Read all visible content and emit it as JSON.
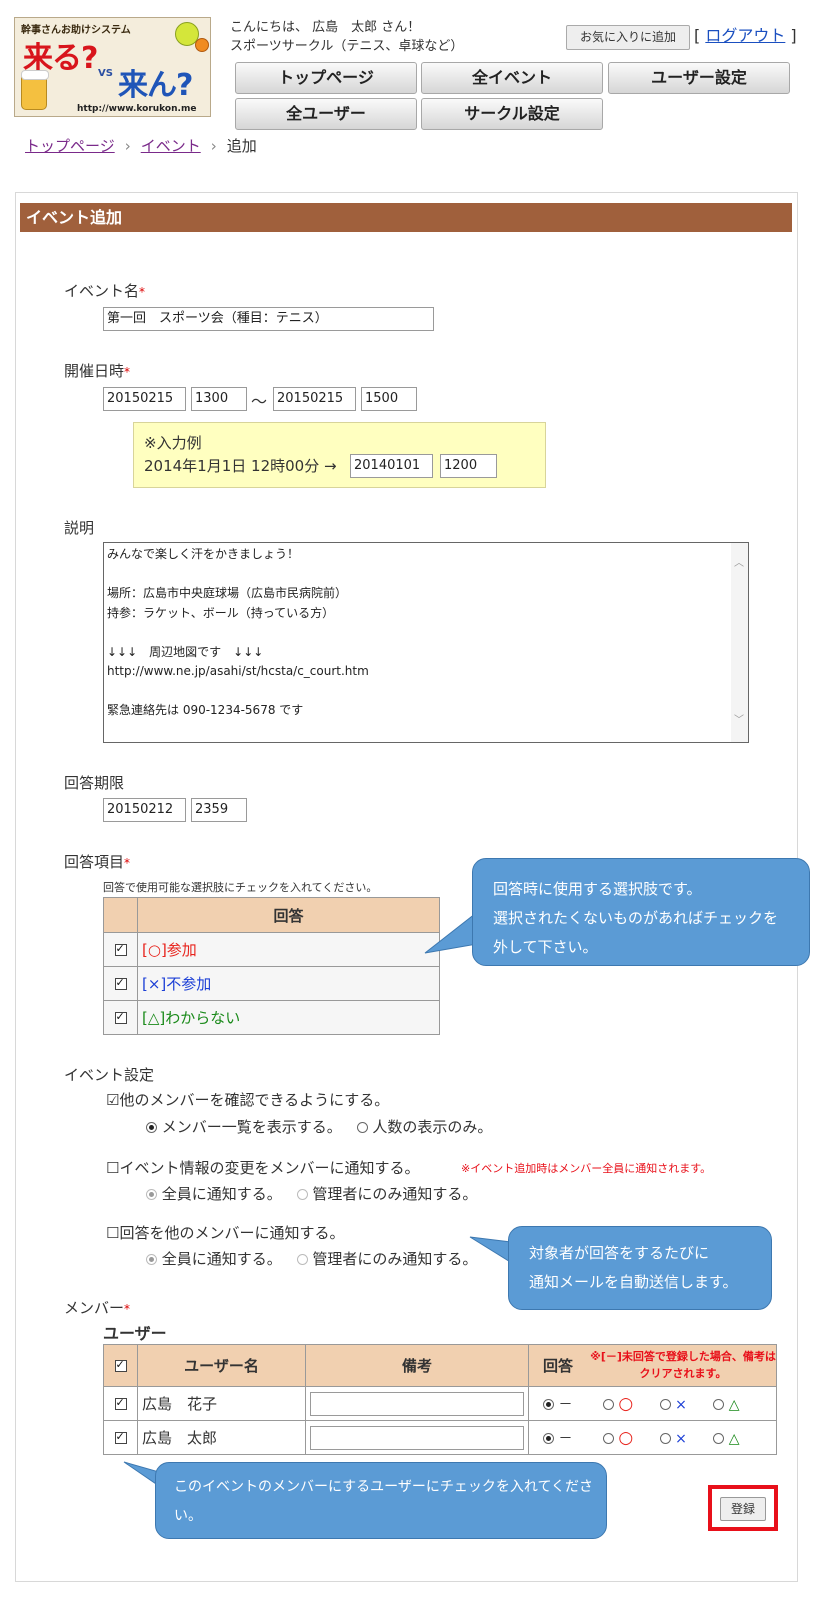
{
  "header": {
    "logo": {
      "tagline": "幹事さんお助けシステム",
      "word1": "来る?",
      "vs": "VS",
      "word2": "来ん?",
      "url": "http://www.korukon.me"
    },
    "greeting": "こんにちは、 広島　太郎 さん！",
    "circle_name": "スポーツサークル（テニス、卓球など）",
    "favorite_button": "お気に入りに追加",
    "logout_label": "ログアウト",
    "nav": [
      "トップページ",
      "全イベント",
      "ユーザー設定",
      "全ユーザー",
      "サークル設定"
    ]
  },
  "breadcrumb": {
    "items": [
      "トップページ",
      "イベント"
    ],
    "current": "追加",
    "separator": "›"
  },
  "panel_title": "イベント追加",
  "form": {
    "event_name_label": "イベント名",
    "required_mark": "*",
    "event_name_value": "第一回　スポーツ会（種目：テニス）",
    "datetime_label": "開催日時",
    "start_date": "20150215",
    "start_time": "1300",
    "tilde": "〜",
    "end_date": "20150215",
    "end_time": "1500",
    "example_title": "※入力例",
    "example_text": "2014年1月1日 12時00分 →",
    "example_date": "20140101",
    "example_time": "1200",
    "description_label": "説明",
    "description_value": "みんなで楽しく汗をかきましょう！\n\n場所：広島市中央庭球場（広島市民病院前）\n持参：ラケット、ボール（持っている方）\n\n↓↓↓　周辺地図です　↓↓↓\nhttp://www.ne.jp/asahi/st/hcsta/c_court.htm\n\n緊急連絡先は 090-1234-5678 です",
    "deadline_label": "回答期限",
    "deadline_date": "20150212",
    "deadline_time": "2359",
    "answer_items_label": "回答項目",
    "answer_items_hint": "回答で使用可能な選択肢にチェックを入れてください。",
    "answer_table_header": "回答",
    "answer_options": [
      {
        "label": "[○]参加",
        "color": "#e8231c",
        "checked": true
      },
      {
        "label": "[×]不参加",
        "color": "#1c3fd6",
        "checked": true
      },
      {
        "label": "[△]わからない",
        "color": "#1a8a1a",
        "checked": true
      }
    ],
    "settings_label": "イベント設定",
    "setting1": {
      "label": "☑他のメンバーを確認できるようにする。",
      "opt_a": "メンバー一覧を表示する。",
      "opt_b": "人数の表示のみ。"
    },
    "setting2": {
      "label": "☐イベント情報の変更をメンバーに通知する。",
      "note": "※イベント追加時はメンバー全員に通知されます。",
      "opt_a": "全員に通知する。",
      "opt_b": "管理者にのみ通知する。"
    },
    "setting3": {
      "label": "☐回答を他のメンバーに通知する。",
      "opt_a": "全員に通知する。",
      "opt_b": "管理者にのみ通知する。"
    },
    "members_label": "メンバー",
    "users_heading": "ユーザー",
    "members_table": {
      "headers": {
        "name": "ユーザー名",
        "remarks": "備考",
        "answer": "回答"
      },
      "answer_note": "※[－]未回答で登録した場合、備考はクリアされます。",
      "answer_symbols": {
        "none": "－",
        "yes": "○",
        "no": "×",
        "maybe": "△"
      },
      "rows": [
        {
          "name": "広島　花子",
          "checked": true,
          "remarks": "",
          "answer": "none"
        },
        {
          "name": "広島　太郎",
          "checked": true,
          "remarks": "",
          "answer": "none"
        }
      ]
    },
    "submit_label": "登録"
  },
  "callouts": {
    "answer_items": "回答時に使用する選択肢です。\n選択されたくないものがあればチェックを\n外して下さい。",
    "notify": "対象者が回答をするたびに\n通知メールを自動送信します。",
    "members": "このイベントのメンバーにするユーザーにチェックを入れてください。"
  }
}
